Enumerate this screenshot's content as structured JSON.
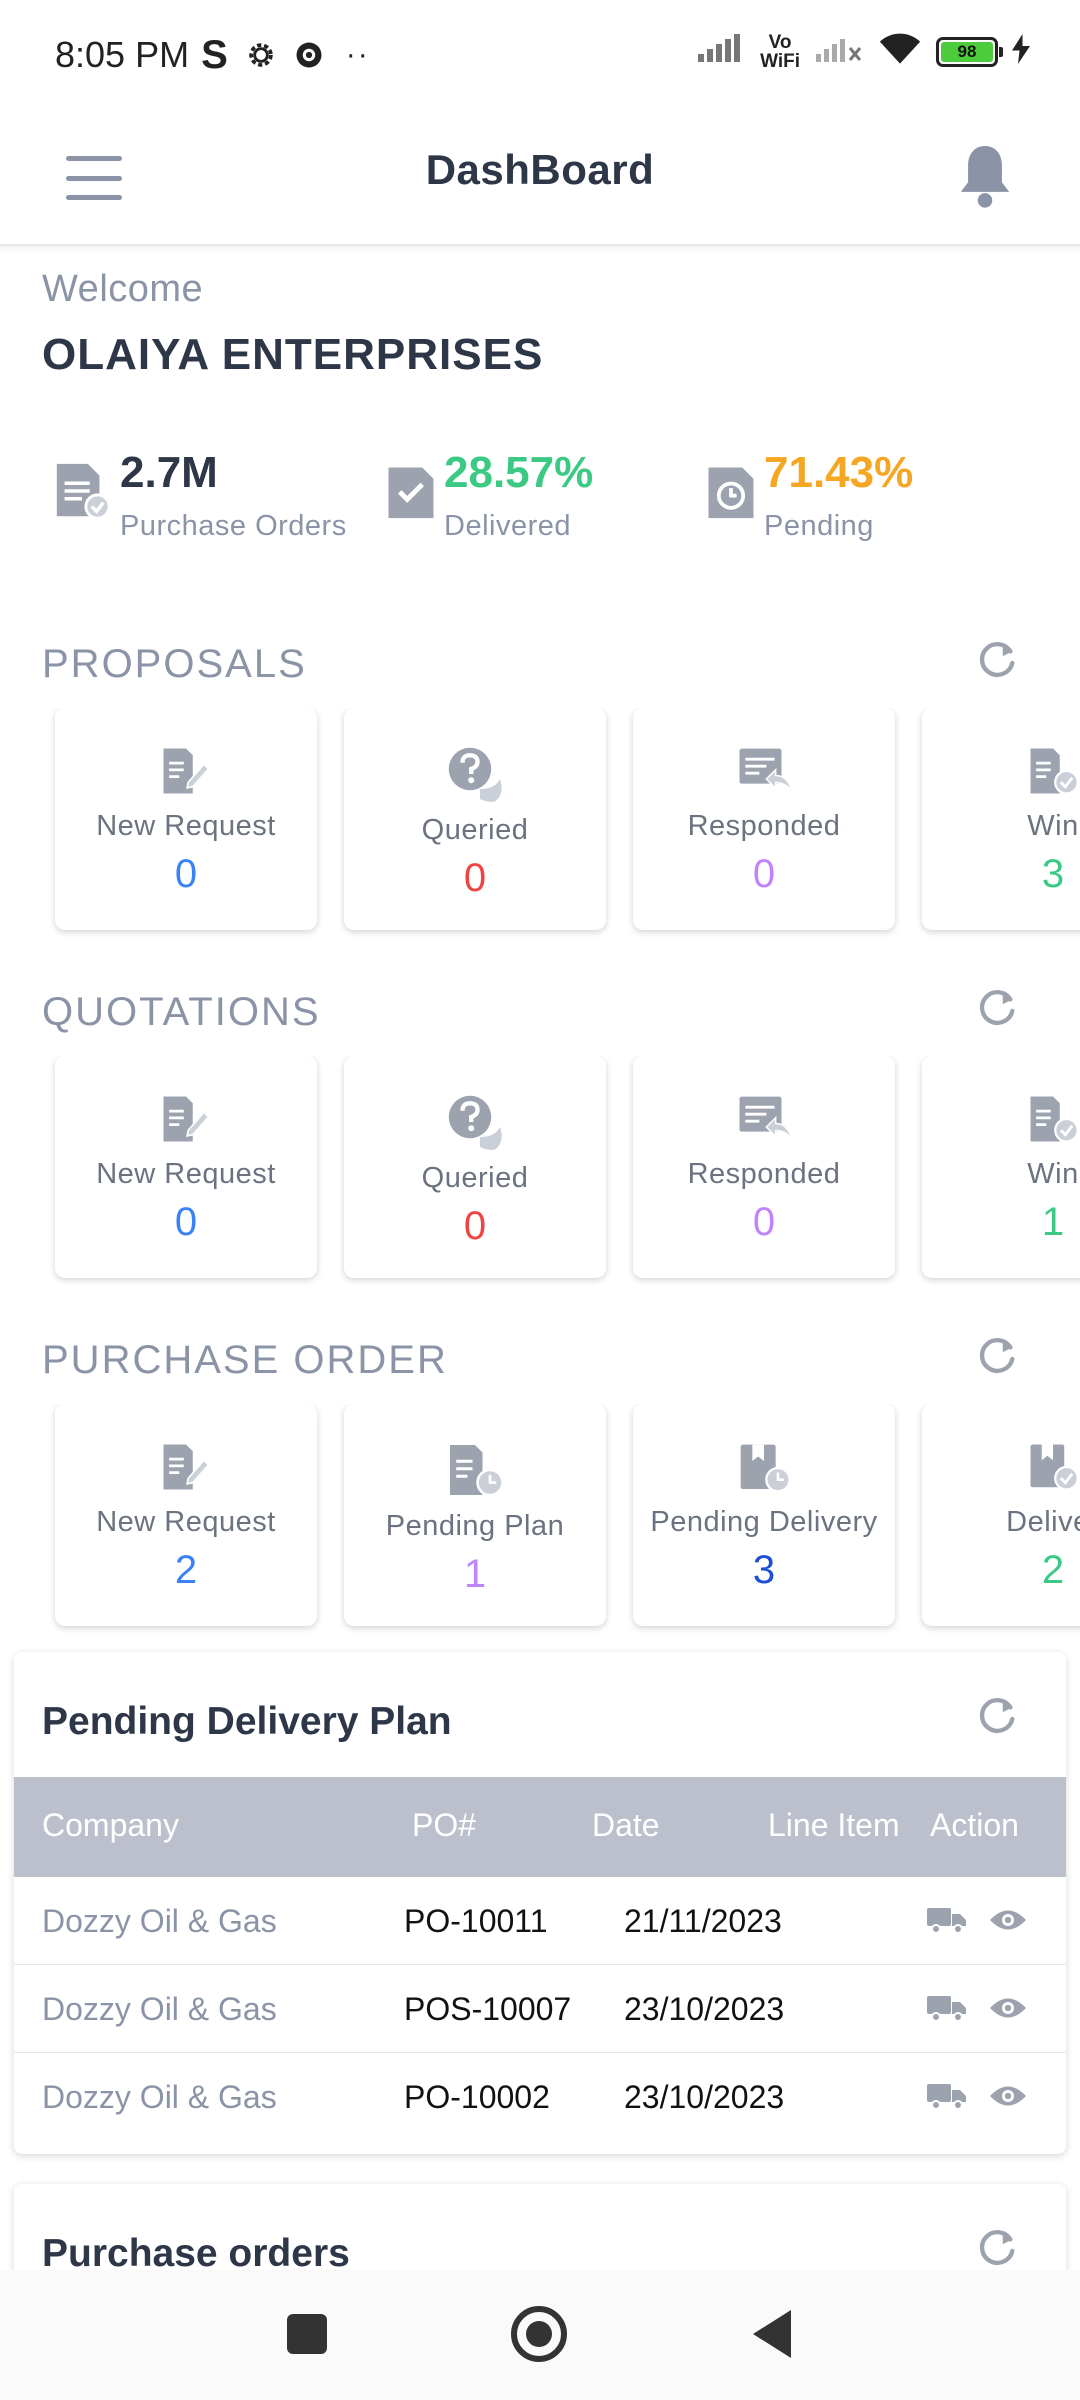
{
  "status_bar": {
    "time": "8:05 PM",
    "s_label": "S",
    "dots": "··",
    "vowifi_top": "Vo",
    "vowifi_bottom": "WiFi",
    "battery": "98"
  },
  "header": {
    "title": "DashBoard"
  },
  "welcome": {
    "greeting": "Welcome",
    "company": "OLAIYA ENTERPRISES"
  },
  "stats": [
    {
      "value": "2.7M",
      "label": "Purchase Orders",
      "color": "#2d3748"
    },
    {
      "value": "28.57%",
      "label": "Delivered",
      "color": "#3cc984"
    },
    {
      "value": "71.43%",
      "label": "Pending",
      "color": "#f5a623"
    }
  ],
  "proposals": {
    "title": "PROPOSALS",
    "cards": [
      {
        "label": "New Request",
        "count": "0",
        "color": "#3b82f6",
        "icon": "document-edit-icon"
      },
      {
        "label": "Queried",
        "count": "0",
        "color": "#ef4444",
        "icon": "question-bubble-icon"
      },
      {
        "label": "Responded",
        "count": "0",
        "color": "#c084fc",
        "icon": "reply-icon"
      },
      {
        "label": "Win",
        "count": "3",
        "color": "#3cc984",
        "icon": "document-check-icon"
      }
    ]
  },
  "quotations": {
    "title": "QUOTATIONS",
    "cards": [
      {
        "label": "New Request",
        "count": "0",
        "color": "#3b82f6",
        "icon": "document-edit-icon"
      },
      {
        "label": "Queried",
        "count": "0",
        "color": "#ef4444",
        "icon": "question-bubble-icon"
      },
      {
        "label": "Responded",
        "count": "0",
        "color": "#c084fc",
        "icon": "reply-icon"
      },
      {
        "label": "Win",
        "count": "1",
        "color": "#3cc984",
        "icon": "document-check-icon"
      }
    ]
  },
  "purchase_order": {
    "title": "PURCHASE ORDER",
    "cards": [
      {
        "label": "New Request",
        "count": "2",
        "color": "#3b82f6",
        "icon": "document-edit-icon"
      },
      {
        "label": "Pending Plan",
        "count": "1",
        "color": "#c084fc",
        "icon": "document-clock-icon"
      },
      {
        "label": "Pending Delivery",
        "count": "3",
        "color": "#1d4ed8",
        "icon": "box-clock-icon"
      },
      {
        "label": "Deliver",
        "count": "2",
        "color": "#3cc984",
        "icon": "box-check-icon"
      }
    ]
  },
  "pending_delivery_plan": {
    "title": "Pending Delivery Plan",
    "columns": [
      "Company",
      "PO#",
      "Date",
      "Line Item",
      "Action"
    ],
    "rows": [
      {
        "company": "Dozzy Oil & Gas",
        "po": "PO-10011",
        "date": "21/11/2023"
      },
      {
        "company": "Dozzy Oil & Gas",
        "po": "POS-10007",
        "date": "23/10/2023"
      },
      {
        "company": "Dozzy Oil & Gas",
        "po": "PO-10002",
        "date": "23/10/2023"
      }
    ]
  },
  "purchase_orders_panel": {
    "title": "Purchase orders"
  }
}
